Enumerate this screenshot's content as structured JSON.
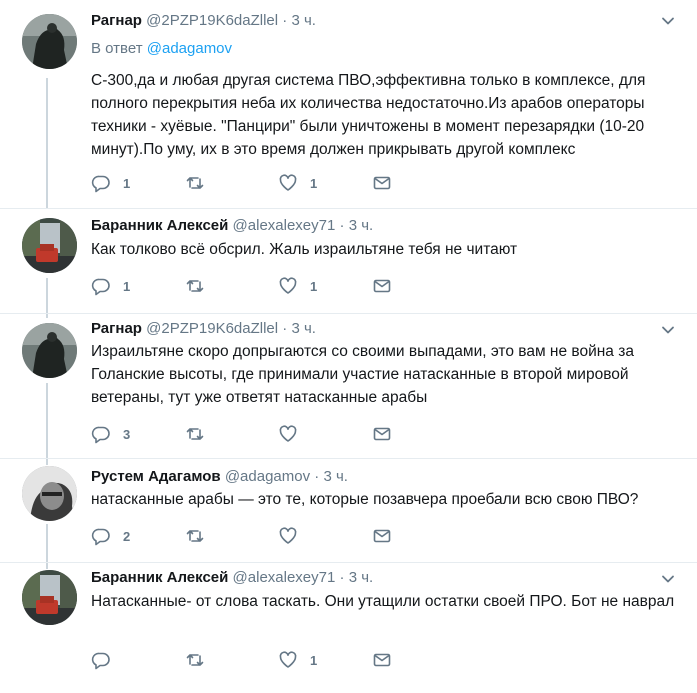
{
  "icons": {
    "reply": "speech-bubble-icon",
    "retweet": "retweet-arrows-icon",
    "like": "heart-icon",
    "message": "envelope-icon",
    "menu": "chevron-down-icon"
  },
  "colors": {
    "text": "#14171a",
    "secondary": "#657786",
    "link": "#1da1f2",
    "thread_line": "#ccd6dd",
    "divider": "#e6ecf0"
  },
  "tweets": [
    {
      "name": "Рагнар",
      "handle": "@2PZP19K6daZllel",
      "dot": "·",
      "time": "3 ч.",
      "reply_prefix": "В ответ",
      "reply_to": "@adagamov",
      "text": "С-300,да и любая другая система ПВО,эффективна только в комплексе, для полного перекрытия неба их количества недостаточно.Из арабов операторы техники - хуёвые. \"Панцири\" были уничтожены в момент перезарядки (10-20 минут).По уму, их в это время должен прикрывать другой комплекс",
      "replies": "1",
      "retweets": "",
      "likes": "1"
    },
    {
      "name": "Баранник Алексей",
      "handle": "@alexalexey71",
      "dot": "·",
      "time": "3 ч.",
      "text": "Как толково всё обсрил. Жаль израильтяне тебя не читают",
      "replies": "1",
      "retweets": "",
      "likes": "1"
    },
    {
      "name": "Рагнар",
      "handle": "@2PZP19K6daZllel",
      "dot": "·",
      "time": "3 ч.",
      "text": "Израильтяне скоро допрыгаются со своими выпадами, это вам не война за Голанские высоты, где принимали участие натасканные в второй мировой ветераны, тут уже ответят натасканные арабы",
      "replies": "3",
      "retweets": "",
      "likes": ""
    },
    {
      "name": "Рустем Адагамов",
      "handle": "@adagamov",
      "dot": "·",
      "time": "3 ч.",
      "text": "натасканные арабы — это те, которые позавчера проебали всю свою ПВО?",
      "replies": "2",
      "retweets": "",
      "likes": ""
    },
    {
      "name": "Баранник Алексей",
      "handle": "@alexalexey71",
      "dot": "·",
      "time": "3 ч.",
      "text": "Натасканные- от слова таскать. Они утащили остатки своей ПРО. Бот не наврал",
      "replies": "",
      "retweets": "",
      "likes": "1"
    }
  ]
}
